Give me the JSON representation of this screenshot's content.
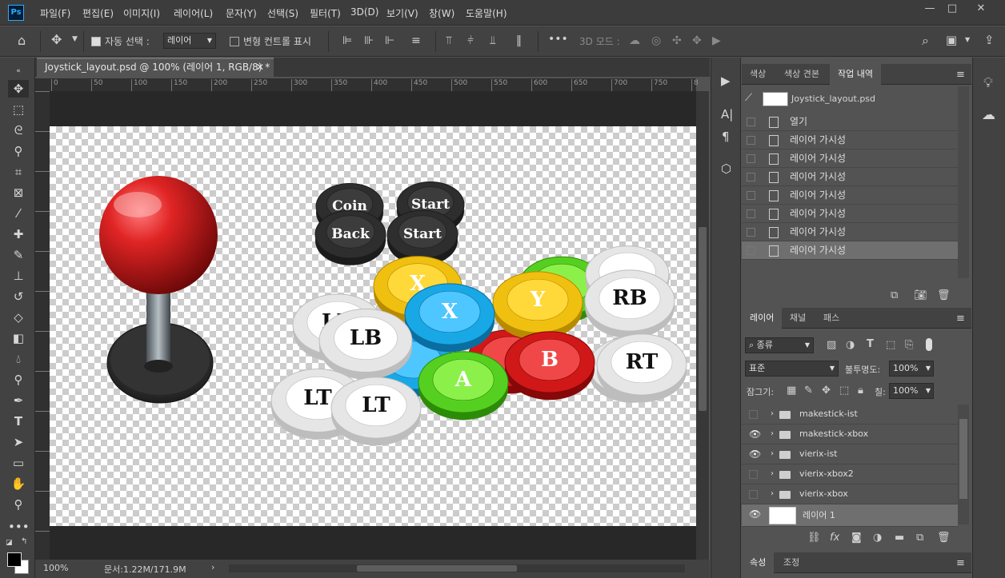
{
  "app": {
    "logo": "Ps"
  },
  "menu": [
    "파일(F)",
    "편집(E)",
    "이미지(I)",
    "레이어(L)",
    "문자(Y)",
    "선택(S)",
    "필터(T)",
    "3D(D)",
    "보기(V)",
    "창(W)",
    "도움말(H)"
  ],
  "window_controls": {
    "minimize": "—",
    "maximize": "□",
    "close": "✕"
  },
  "options": {
    "auto_select_label": "자동 선택 :",
    "auto_select_target": "레이어",
    "transform_controls_label": "변형 컨트롤 표시",
    "more": "•••",
    "mode_3d_label": "3D 모드 :"
  },
  "document": {
    "tab_title": "Joystick_layout.psd @ 100% (레이어 1, RGB/8) *",
    "zoom": "100%",
    "doc_size": "문서:1.22M/171.9M"
  },
  "ruler": {
    "top_ticks": [
      "0",
      "50",
      "100",
      "150",
      "200",
      "250",
      "300",
      "350",
      "400",
      "450",
      "500",
      "550",
      "600",
      "650",
      "700",
      "750",
      "8"
    ]
  },
  "canvas_labels": {
    "coin": "Coin",
    "back": "Back",
    "start": "Start",
    "x": "X",
    "y": "Y",
    "a": "A",
    "b": "B",
    "lb": "LB",
    "lt": "LT",
    "rb": "RB",
    "rt": "RT"
  },
  "history_panel": {
    "tabs": [
      "색상",
      "색상 견본",
      "작업 내역"
    ],
    "active_tab": 2,
    "snapshot_name": "Joystick_layout.psd",
    "items": [
      "열기",
      "레이어 가시성",
      "레이어 가시성",
      "레이어 가시성",
      "레이어 가시성",
      "레이어 가시성",
      "레이어 가시성",
      "레이어 가시성"
    ],
    "selected_index": 7
  },
  "layers_panel": {
    "tabs": [
      "레이어",
      "채널",
      "패스"
    ],
    "active_tab": 0,
    "filter_label": "종류",
    "blend_mode": "표준",
    "opacity_label": "불투명도:",
    "opacity_value": "100%",
    "lock_label": "잠그기:",
    "fill_label": "칠:",
    "fill_value": "100%",
    "layers": [
      {
        "name": "makestick-ist",
        "visible": false,
        "type": "group"
      },
      {
        "name": "makestick-xbox",
        "visible": true,
        "type": "group"
      },
      {
        "name": "vierix-ist",
        "visible": true,
        "type": "group"
      },
      {
        "name": "vierix-xbox2",
        "visible": false,
        "type": "group"
      },
      {
        "name": "vierix-xbox",
        "visible": false,
        "type": "group"
      },
      {
        "name": "레이어 1",
        "visible": true,
        "type": "layer"
      }
    ]
  },
  "props_panel": {
    "tabs": [
      "속성",
      "조정"
    ]
  },
  "colors": {
    "accent": "#31a8ff",
    "ball_red": "#d42020",
    "btn_yellow": "#f0c010",
    "btn_blue": "#19a8e6",
    "btn_green": "#55d020",
    "btn_red": "#d01818"
  }
}
